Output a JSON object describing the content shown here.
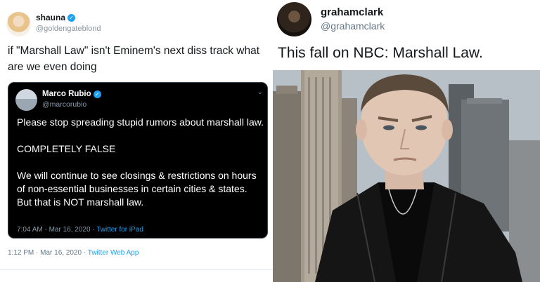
{
  "left_tweet": {
    "author_name": "shauna",
    "author_handle": "@goldengateblond",
    "text": "if \"Marshall Law\" isn't Eminem's next diss track what are we even doing",
    "timestamp": "1:12 PM · Mar 16, 2020 · ",
    "source": "Twitter Web App",
    "quoted_tweet": {
      "author_name": "Marco Rubio",
      "author_handle": "@marcorubio",
      "paragraphs": [
        "Please stop spreading stupid rumors about marshall law.",
        "COMPLETELY FALSE",
        "We will continue to see closings & restrictions on hours of non-essential businesses in certain cities & states. But that is NOT marshall law."
      ],
      "timestamp": "7:04 AM · Mar 16, 2020 · ",
      "source": "Twitter for iPad"
    }
  },
  "right_tweet": {
    "author_name": "grahamclark",
    "author_handle": "@grahamclark",
    "text": "This fall on NBC: Marshall Law."
  },
  "icons": {
    "verified": "verified-badge-icon",
    "chevron": "chevron-down-icon"
  },
  "colors": {
    "link_blue": "#1da1f2",
    "dark_card_bg": "#000000",
    "muted_text": "#657786"
  }
}
